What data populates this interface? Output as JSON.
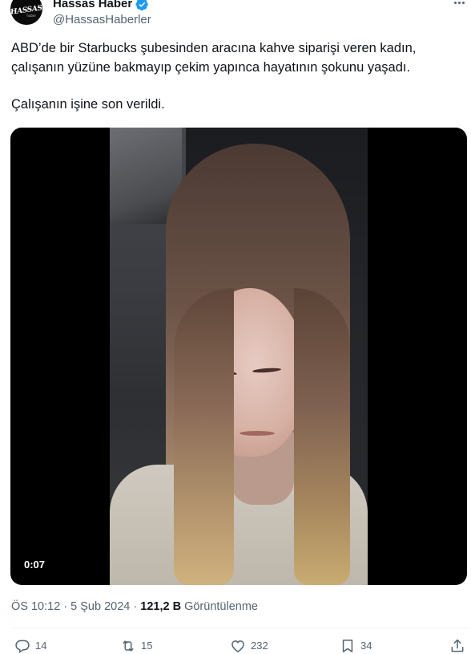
{
  "author": {
    "display_name": "Hassas Haber",
    "handle": "@HassasHaberler",
    "avatar_text": "HASSAS",
    "avatar_subtext": "haber",
    "verified": true
  },
  "tweet": {
    "paragraph_1_line_1": "ABD’de bir Starbucks şubesinden aracına kahve siparişi veren kadın,",
    "paragraph_1_line_2": "çalışanın yüzüne bakmayıp çekim yapınca hayatının şokunu yaşadı.",
    "paragraph_2": "Çalışanın işine son verildi."
  },
  "media": {
    "type": "video",
    "duration": "0:07"
  },
  "meta": {
    "time": "ÖS 10:12",
    "separator": "·",
    "date": "5 Şub 2024",
    "views_count": "121,2 B",
    "views_label": "Görüntülenme"
  },
  "actions": {
    "replies": "14",
    "retweets": "15",
    "likes": "232",
    "bookmarks": "34"
  },
  "colors": {
    "text_primary": "#0f1419",
    "text_secondary": "#536471",
    "verified_blue": "#1d9bf0",
    "divider": "#eff3f4"
  },
  "icons": {
    "more": "more-icon",
    "verified": "verified-badge-icon",
    "reply": "reply-icon",
    "retweet": "retweet-icon",
    "like": "heart-icon",
    "bookmark": "bookmark-icon",
    "share": "share-icon"
  }
}
